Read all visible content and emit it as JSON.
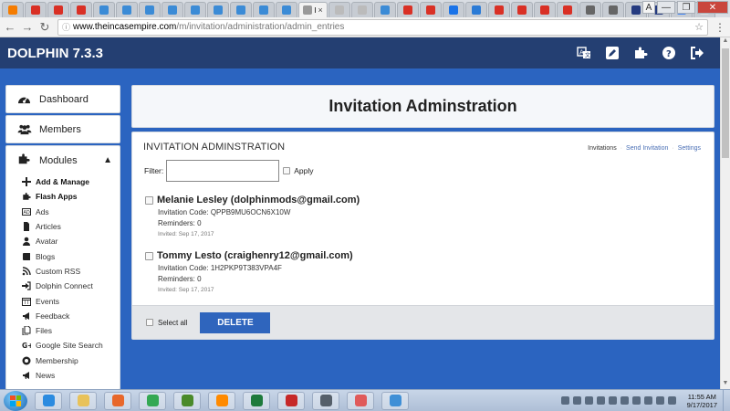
{
  "browser": {
    "tabs": [
      {
        "icon": "blogger-icon",
        "color": "#f57c00"
      },
      {
        "icon": "gmail-icon",
        "color": "#d93025"
      },
      {
        "icon": "gmail-icon",
        "color": "#d93025"
      },
      {
        "icon": "gmail-icon",
        "color": "#d93025"
      },
      {
        "icon": "infinity-icon",
        "color": "#3b8bd6"
      },
      {
        "icon": "infinity-icon",
        "color": "#3b8bd6"
      },
      {
        "icon": "infinity-icon",
        "color": "#3b8bd6"
      },
      {
        "icon": "infinity-icon",
        "color": "#3b8bd6"
      },
      {
        "icon": "infinity-icon",
        "color": "#3b8bd6"
      },
      {
        "icon": "infinity-icon",
        "color": "#3b8bd6"
      },
      {
        "icon": "infinity-icon",
        "color": "#3b8bd6"
      },
      {
        "icon": "infinity-icon",
        "color": "#3b8bd6"
      },
      {
        "icon": "infinity-icon",
        "color": "#3b8bd6"
      },
      {
        "icon": "page-icon",
        "color": "#999999",
        "active": true,
        "label": "I"
      },
      {
        "icon": "page-icon",
        "color": "#bbbbbb"
      },
      {
        "icon": "page-icon",
        "color": "#bbbbbb"
      },
      {
        "icon": "infinity-icon",
        "color": "#3b8bd6"
      },
      {
        "icon": "s-icon",
        "color": "#d93025"
      },
      {
        "icon": "pause-icon",
        "color": "#d93025"
      },
      {
        "icon": "info-icon",
        "color": "#1a73e8"
      },
      {
        "icon": "edge-icon",
        "color": "#2b7bd6"
      },
      {
        "icon": "pause-icon",
        "color": "#d93025"
      },
      {
        "icon": "pause-icon",
        "color": "#d93025"
      },
      {
        "icon": "pause-icon",
        "color": "#d93025"
      },
      {
        "icon": "pause-icon",
        "color": "#d93025"
      },
      {
        "icon": "sound-icon",
        "color": "#666666"
      },
      {
        "icon": "printer-icon",
        "color": "#666666"
      },
      {
        "icon": "paypal-icon",
        "color": "#253b80"
      },
      {
        "icon": "paypal-icon",
        "color": "#253b80"
      },
      {
        "icon": "google-icon",
        "color": "#4285f4"
      },
      {
        "icon": "blank-icon",
        "color": "#dddddd"
      }
    ],
    "window_controls": {
      "profile": "A",
      "minimize": "—",
      "maximize": "❐",
      "close": "✕"
    },
    "url_host": "www.theincasempire.com",
    "url_path": "/m/invitation/administration/admin_entries"
  },
  "app": {
    "brand": "DOLPHIN 7.3.3",
    "header_icons": [
      "translate-icon",
      "edit-icon",
      "puzzle-icon",
      "help-icon",
      "logout-icon"
    ]
  },
  "sidebar": {
    "dashboard": "Dashboard",
    "members": "Members",
    "modules": "Modules",
    "module_items": [
      {
        "label": "Add & Manage",
        "icon": "plus-icon",
        "bold": true
      },
      {
        "label": "Flash Apps",
        "icon": "puzzle-icon",
        "bold": true
      },
      {
        "label": "Ads",
        "icon": "ads-icon"
      },
      {
        "label": "Articles",
        "icon": "file-icon"
      },
      {
        "label": "Avatar",
        "icon": "user-icon"
      },
      {
        "label": "Blogs",
        "icon": "book-icon"
      },
      {
        "label": "Custom RSS",
        "icon": "rss-icon"
      },
      {
        "label": "Dolphin Connect",
        "icon": "sign-in-icon"
      },
      {
        "label": "Events",
        "icon": "calendar-icon"
      },
      {
        "label": "Feedback",
        "icon": "bullhorn-icon"
      },
      {
        "label": "Files",
        "icon": "files-icon"
      },
      {
        "label": "Google Site Search",
        "icon": "google-plus-icon"
      },
      {
        "label": "Membership",
        "icon": "certificate-icon"
      },
      {
        "label": "News",
        "icon": "bullhorn-icon"
      }
    ]
  },
  "main": {
    "page_title": "Invitation Adminstration",
    "section_title": "INVITATION ADMINSTRATION",
    "links": {
      "invitations": "Invitations",
      "send_invitation": "Send Invitation",
      "settings": "Settings"
    },
    "filter_label": "Filter:",
    "filter_value": "",
    "apply_label": "Apply",
    "entries": [
      {
        "name": "Melanie Lesley (dolphinmods@gmail.com)",
        "code": "Invitation Code: QPPB9MU6OCN6X10W",
        "reminders": "Reminders: 0",
        "invited": "Invited: Sep 17, 2017"
      },
      {
        "name": "Tommy Lesto (craighenry12@gmail.com)",
        "code": "Invitation Code: 1H2PKP9T383VPA4F",
        "reminders": "Reminders: 0",
        "invited": "Invited: Sep 17, 2017"
      }
    ],
    "select_all_label": "Select all",
    "delete_label": "DELETE"
  },
  "taskbar": {
    "apps": [
      {
        "icon": "internet-explorer-icon",
        "color": "#2b8be0"
      },
      {
        "icon": "folder-icon",
        "color": "#e8c25a"
      },
      {
        "icon": "firefox-icon",
        "color": "#e8672a"
      },
      {
        "icon": "chrome-icon",
        "color": "#34a853"
      },
      {
        "icon": "frog-icon",
        "color": "#4a8a2a"
      },
      {
        "icon": "media-player-icon",
        "color": "#ff8a00"
      },
      {
        "icon": "excel-icon",
        "color": "#1e7a3c"
      },
      {
        "icon": "filezilla-icon",
        "color": "#c62828"
      },
      {
        "icon": "security-icon",
        "color": "#555f6a"
      },
      {
        "icon": "eraser-icon",
        "color": "#e05a5a"
      },
      {
        "icon": "paint-icon",
        "color": "#3f8fd6"
      }
    ],
    "time": "11:55 AM",
    "date": "9/17/2017"
  },
  "colors": {
    "header_bg": "#243f72",
    "page_bg": "#2b64c0",
    "accent": "#2f65bd",
    "link": "#4a6fb5"
  }
}
